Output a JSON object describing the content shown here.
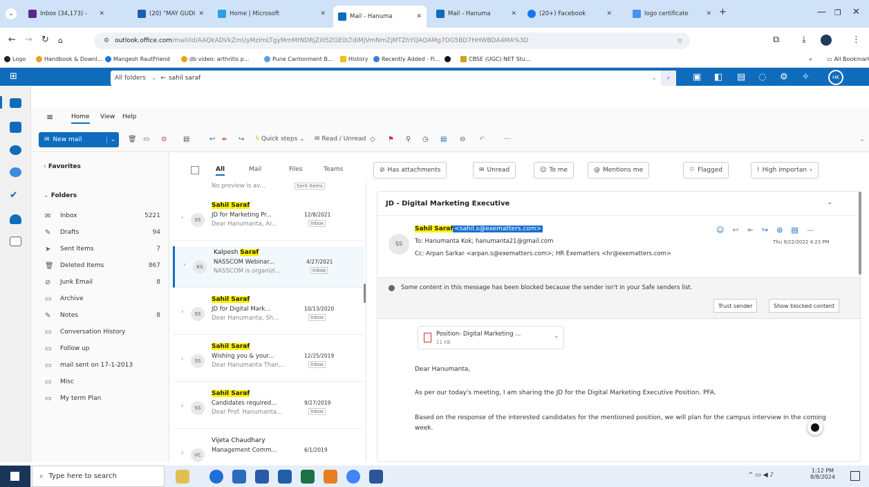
{
  "browser": {
    "tabs": [
      {
        "label": "Inbox (34,173) -",
        "color": "#5b2a8c"
      },
      {
        "label": "(20) \"MAY GUDI\"",
        "color": "#1a5fb4"
      },
      {
        "label": "Home | Microsoft",
        "color": "#2aa1e6"
      },
      {
        "label": "Mail - Hanuma",
        "color": "#0f6cbd"
      },
      {
        "label": "Mail - Hanuma",
        "color": "#0f6cbd"
      },
      {
        "label": "(20+) Facebook",
        "color": "#1877f2"
      },
      {
        "label": "logo certificate",
        "color": "#4a8ff0"
      }
    ],
    "url_domain": "outlook.office.com",
    "url_path": "/mail/id/AAQkADVkZmUyMzlmLTgyMmMtNDRjZi05ZGE0LTdiMjVmNmZjMTZhYQAQAMg7DG5BD7HHWBDA4MA%3D",
    "bookmarks": [
      "Logo",
      "Handbook & Downl...",
      "Mangesh RautFriend",
      "db video: arthritis p...",
      "Pune Cantonment B...",
      "History",
      "Recently Added - Fi...",
      "CBSE (UGC) NET Stu..."
    ],
    "all_bookmarks": "All Bookmarks"
  },
  "outlook": {
    "search_scope": "All folders",
    "search_value": "sahil saraf",
    "avatar": "HK",
    "ribbon_tabs": [
      "Home",
      "View",
      "Help"
    ],
    "new_mail": "New mail",
    "quick_steps": "Quick steps",
    "read_unread": "Read / Unread",
    "favorites": "Favorites",
    "folders_label": "Folders",
    "folders": [
      {
        "name": "Inbox",
        "count": "5221"
      },
      {
        "name": "Drafts",
        "count": "94"
      },
      {
        "name": "Sent Items",
        "count": "7"
      },
      {
        "name": "Deleted Items",
        "count": "867"
      },
      {
        "name": "Junk Email",
        "count": "8"
      },
      {
        "name": "Archive",
        "count": ""
      },
      {
        "name": "Notes",
        "count": "8"
      },
      {
        "name": "Conversation History",
        "count": ""
      },
      {
        "name": "Follow up",
        "count": ""
      },
      {
        "name": "mail sent on 17-1-2013",
        "count": ""
      },
      {
        "name": "Misc",
        "count": ""
      },
      {
        "name": "My term Plan",
        "count": ""
      }
    ],
    "filters": [
      "All",
      "Mail",
      "Files",
      "Teams",
      "Has attachments",
      "Unread",
      "To me",
      "Mentions me",
      "Flagged",
      "High importan"
    ]
  },
  "messages": {
    "top_preview": "No preview is av...",
    "top_tag": "Sent Items",
    "items": [
      {
        "from_pre": "",
        "from_hl": "Sahil Saraf",
        "from_post": "",
        "initials": "SS",
        "subject": "JD for Marketing Pr...",
        "date": "12/8/2021",
        "preview": "Dear Hanumanta, Ar...",
        "tag": "Inbox"
      },
      {
        "from_pre": "Kalpesh ",
        "from_hl": "Saraf",
        "from_post": "",
        "initials": "KS",
        "subject": "NASSCOM Webinar...",
        "date": "4/27/2021",
        "preview": "NASSCOM is organizi...",
        "tag": "Inbox"
      },
      {
        "from_pre": "",
        "from_hl": "Sahil Saraf",
        "from_post": "",
        "initials": "SS",
        "subject": "JD for Digital Mark...",
        "date": "10/13/2020",
        "preview": "Dear Hanumanta, Sh...",
        "tag": "Inbox"
      },
      {
        "from_pre": "",
        "from_hl": "Sahil Saraf",
        "from_post": "",
        "initials": "SS",
        "subject": "Wishing you & your...",
        "date": "12/25/2019",
        "preview": "Dear Hanumanta Than...",
        "tag": "Inbox"
      },
      {
        "from_pre": "",
        "from_hl": "Sahil Saraf",
        "from_post": "",
        "initials": "SS",
        "subject": "Candidates required...",
        "date": "9/27/2019",
        "preview": "Dear Prof. Hanumanta...",
        "tag": "Inbox"
      },
      {
        "from_pre": "Vijeta Chaudhary",
        "from_hl": "",
        "from_post": "",
        "initials": "VC",
        "subject": "Management Comm...",
        "date": "6/1/2019",
        "preview": "",
        "tag": ""
      }
    ]
  },
  "reading": {
    "subject": "JD - Digital Marketing Executive",
    "sender_initials": "SS",
    "sender_name": "Sahil Saraf",
    "sender_email": "<sahil.s@exematters.com>",
    "to": "To:  Hanumanta Kok;  hanumanta21@gmail.com",
    "cc": "Cc:  Arpan Sarkar <arpan.s@exematters.com>;  HR Exematters <hr@exematters.com>",
    "datetime": "Thu 9/22/2022 4:23 PM",
    "blocked_notice": "Some content in this message has been blocked because the sender isn't in your Safe senders list.",
    "trust_sender": "Trust sender",
    "show_blocked": "Show blocked content",
    "attachment_name": "Position- Digital Marketing ...",
    "attachment_size": "21 KB",
    "body": [
      "Dear Hanumanta,",
      "As per our today's meeting, I am sharing the JD for the Digital Marketing Executive Position. PFA.",
      "Based on the response of the interested candidates for the mentioned position, we will plan for the campus interview in the coming week."
    ]
  },
  "taskbar": {
    "search_placeholder": "Type here to search",
    "time": "1:12 PM",
    "date": "8/8/2024"
  }
}
